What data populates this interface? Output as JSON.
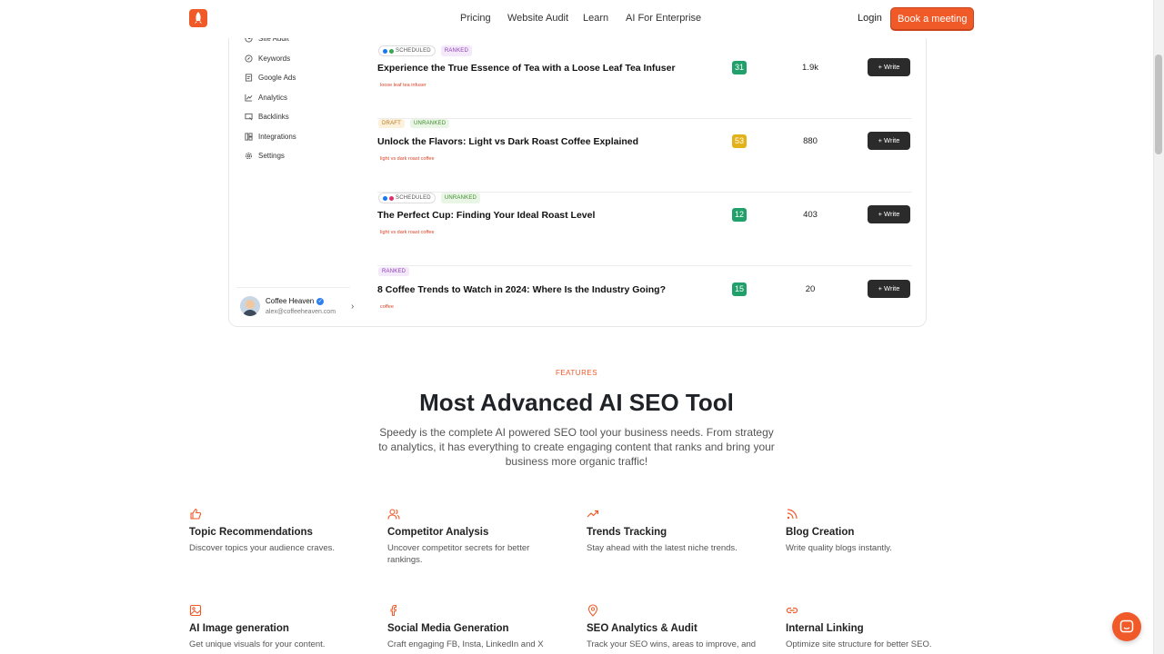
{
  "nav": {
    "links": [
      "Pricing",
      "Website Audit",
      "Learn",
      "AI For Enterprise"
    ],
    "login": "Login",
    "cta": "Book a meeting"
  },
  "sidebar": {
    "items": [
      "Site Audit",
      "Keywords",
      "Google Ads",
      "Analytics",
      "Backlinks",
      "Integrations",
      "Settings"
    ],
    "profile": {
      "name": "Coffee Heaven",
      "email": "alex@coffeeheaven.com"
    }
  },
  "articles": [
    {
      "badges": [
        {
          "label": "Scheduled",
          "kind": "sched"
        },
        {
          "label": "Ranked",
          "kind": "ranked"
        }
      ],
      "title": "Experience the True Essence of Tea with a Loose Leaf Tea Infuser",
      "keyword": "loose leaf tea infuser",
      "score": "31",
      "score_color": "#22a06b",
      "volume": "1.9k",
      "write": "Write"
    },
    {
      "badges": [
        {
          "label": "Draft",
          "kind": "draft"
        },
        {
          "label": "Unranked",
          "kind": "unranked"
        }
      ],
      "title": "Unlock the Flavors: Light vs Dark Roast Coffee Explained",
      "keyword": "light vs dark roast coffee",
      "score": "53",
      "score_color": "#e3b21b",
      "volume": "880",
      "write": "Write"
    },
    {
      "badges": [
        {
          "label": "Scheduled",
          "kind": "sched"
        },
        {
          "label": "Unranked",
          "kind": "unranked"
        }
      ],
      "title": "The Perfect Cup: Finding Your Ideal Roast Level",
      "keyword": "light vs dark roast coffee",
      "score": "12",
      "score_color": "#22a06b",
      "volume": "403",
      "write": "Write"
    },
    {
      "badges": [
        {
          "label": "Ranked",
          "kind": "ranked"
        }
      ],
      "title": "8 Coffee Trends to Watch in 2024: Where Is the Industry Going?",
      "keyword": "coffee",
      "score": "15",
      "score_color": "#22a06b",
      "volume": "20",
      "write": "Write"
    }
  ],
  "features": {
    "tag": "FEATURES",
    "title": "Most Advanced AI SEO Tool",
    "description": "Speedy is the complete AI powered SEO tool your business needs. From strategy to analytics, it has everything to create engaging content that ranks and bring your business more organic traffic!",
    "items": [
      {
        "icon": "thumbs-up-icon",
        "title": "Topic Recommendations",
        "desc": "Discover topics your audience craves."
      },
      {
        "icon": "users-icon",
        "title": "Competitor Analysis",
        "desc": "Uncover competitor secrets for better rankings."
      },
      {
        "icon": "trending-up-icon",
        "title": "Trends Tracking",
        "desc": "Stay ahead with the latest niche trends."
      },
      {
        "icon": "rss-icon",
        "title": "Blog Creation",
        "desc": "Write quality blogs instantly."
      },
      {
        "icon": "image-icon",
        "title": "AI Image generation",
        "desc": "Get unique visuals for your content."
      },
      {
        "icon": "facebook-icon",
        "title": "Social Media Generation",
        "desc": "Craft engaging FB, Insta, LinkedIn and X"
      },
      {
        "icon": "map-pin-icon",
        "title": "SEO Analytics & Audit",
        "desc": "Track your SEO wins, areas to improve, and"
      },
      {
        "icon": "link-icon",
        "title": "Internal Linking",
        "desc": "Optimize site structure for better SEO."
      }
    ]
  },
  "colors": {
    "accent": "#f05a28",
    "dark_button": "#2b2b2b"
  }
}
